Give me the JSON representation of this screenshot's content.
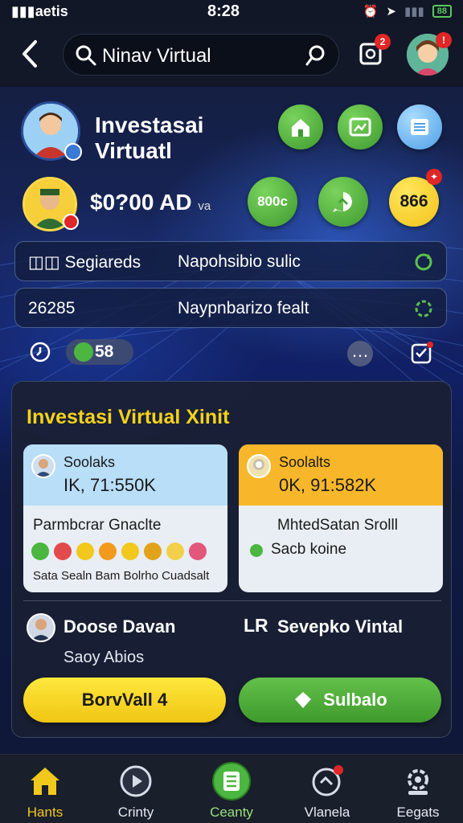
{
  "status_bar": {
    "carrier": "aetis",
    "time": "8:28",
    "battery": "88"
  },
  "header": {
    "search_text": "Ninav Virtual",
    "notif_badge": "2"
  },
  "profile": {
    "title_line1": "Investasai",
    "title_line2": "Virtuatl"
  },
  "balance": {
    "amount": "$0?00 AD",
    "unit": "va",
    "btn_left": "800c",
    "btn_right": "866"
  },
  "rows": [
    {
      "label": "Segiareds",
      "value": "Napohsibio sulic"
    },
    {
      "label": "26285",
      "value": "Naypnbarizo fealt"
    }
  ],
  "counter": {
    "value": "58",
    "prefix": "0"
  },
  "card": {
    "title": "Investasi Virtual Xinit",
    "left": {
      "name": "Soolaks",
      "value": "IK, 71:550K",
      "body": "Parmbcrar Gnaclte",
      "foot": "Sata Sealn Bam Bolrho Cuadsalt"
    },
    "right": {
      "name": "Soolalts",
      "value": "0K, 91:582K",
      "body": "MhtedSatan Srolll",
      "sub": "Sacb koine"
    },
    "person_name": "Doose Davan",
    "person_sub": "Saoy Abios",
    "lr_mark": "LR",
    "lr_text": "Sevepko Vintal",
    "btn_left": "BorvVall 4",
    "btn_right": "Sulbalo"
  },
  "nav": [
    {
      "label": "Hants"
    },
    {
      "label": "Crinty"
    },
    {
      "label": "Ceanty"
    },
    {
      "label": "Vlanela"
    },
    {
      "label": "Eegats"
    }
  ],
  "colors": {
    "accent_yellow": "#f4d21a",
    "accent_green": "#4bb640",
    "accent_blue": "#4f9fe6",
    "badge_red": "#e02626"
  }
}
